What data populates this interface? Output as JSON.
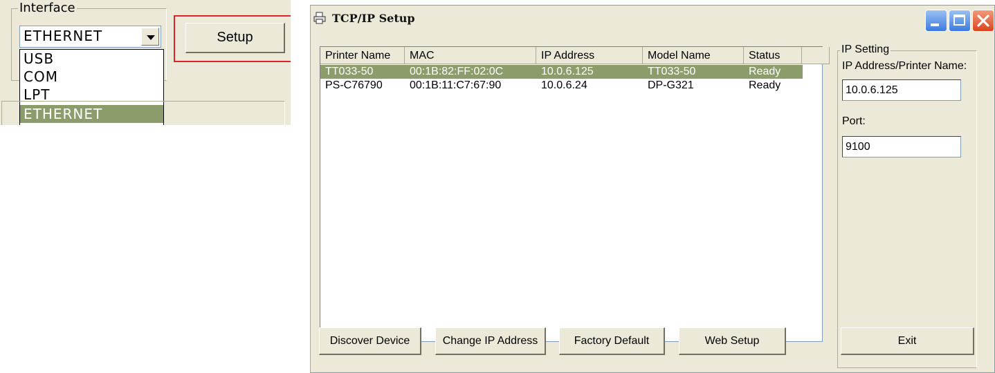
{
  "interface_panel": {
    "group_label": "Interface",
    "selected_value": "ETHERNET",
    "options": [
      {
        "label": "USB",
        "selected": false
      },
      {
        "label": "COM",
        "selected": false
      },
      {
        "label": "LPT",
        "selected": false
      },
      {
        "label": "ETHERNET",
        "selected": true
      }
    ],
    "setup_button": "Setup",
    "highlight_color": "#e0202a"
  },
  "window": {
    "title": "TCP/IP Setup",
    "icon": "printer-icon",
    "controls": [
      "minimize-icon",
      "maximize-icon",
      "close-icon"
    ]
  },
  "device_list": {
    "columns": [
      "Printer Name",
      "MAC",
      "IP Address",
      "Model Name",
      "Status"
    ],
    "rows": [
      {
        "name": "TT033-50",
        "mac": "00:1B:82:FF:02:0C",
        "ip": "10.0.6.125",
        "model": "TT033-50",
        "status": "Ready",
        "selected": true
      },
      {
        "name": "PS-C76790",
        "mac": "00:1B:11:C7:67:90",
        "ip": "10.0.6.24",
        "model": "DP-G321",
        "status": "Ready",
        "selected": false
      }
    ],
    "selection_color": "#8d9c6b"
  },
  "ip_setting": {
    "group_label": "IP Setting",
    "address_label": "IP Address/Printer Name:",
    "address_value": "10.0.6.125",
    "port_label": "Port:",
    "port_value": "9100"
  },
  "buttons": {
    "discover": "Discover Device",
    "change_ip": "Change IP Address",
    "factory_default": "Factory Default",
    "web_setup": "Web Setup",
    "exit": "Exit"
  }
}
